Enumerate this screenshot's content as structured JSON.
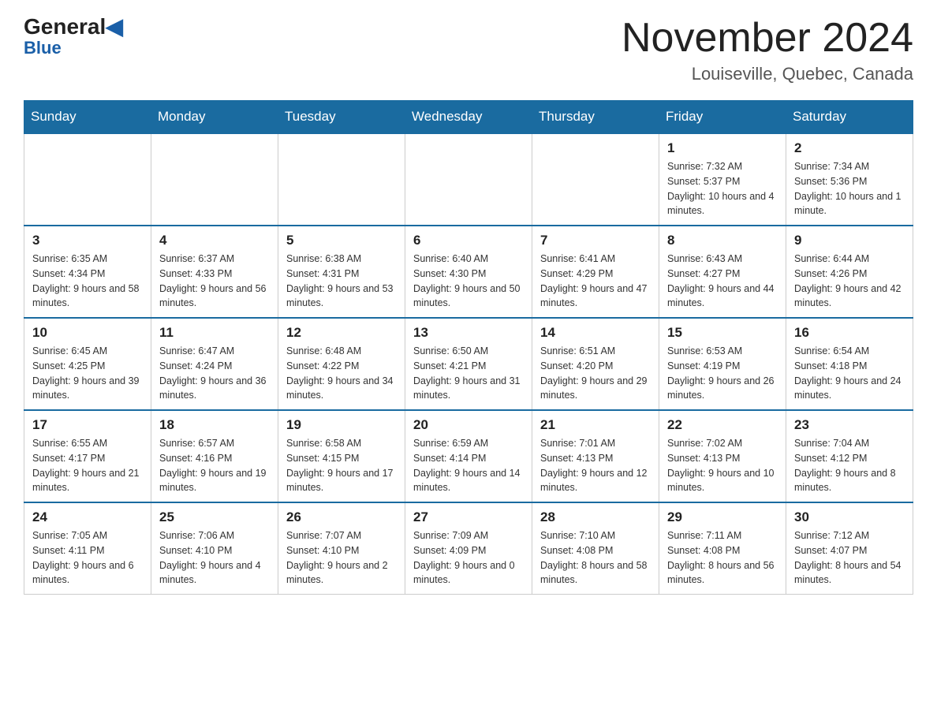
{
  "header": {
    "logo": {
      "general": "General",
      "blue": "Blue"
    },
    "month_title": "November 2024",
    "location": "Louiseville, Quebec, Canada"
  },
  "days_of_week": [
    "Sunday",
    "Monday",
    "Tuesday",
    "Wednesday",
    "Thursday",
    "Friday",
    "Saturday"
  ],
  "weeks": [
    [
      {
        "day": "",
        "info": ""
      },
      {
        "day": "",
        "info": ""
      },
      {
        "day": "",
        "info": ""
      },
      {
        "day": "",
        "info": ""
      },
      {
        "day": "",
        "info": ""
      },
      {
        "day": "1",
        "info": "Sunrise: 7:32 AM\nSunset: 5:37 PM\nDaylight: 10 hours and 4 minutes."
      },
      {
        "day": "2",
        "info": "Sunrise: 7:34 AM\nSunset: 5:36 PM\nDaylight: 10 hours and 1 minute."
      }
    ],
    [
      {
        "day": "3",
        "info": "Sunrise: 6:35 AM\nSunset: 4:34 PM\nDaylight: 9 hours and 58 minutes."
      },
      {
        "day": "4",
        "info": "Sunrise: 6:37 AM\nSunset: 4:33 PM\nDaylight: 9 hours and 56 minutes."
      },
      {
        "day": "5",
        "info": "Sunrise: 6:38 AM\nSunset: 4:31 PM\nDaylight: 9 hours and 53 minutes."
      },
      {
        "day": "6",
        "info": "Sunrise: 6:40 AM\nSunset: 4:30 PM\nDaylight: 9 hours and 50 minutes."
      },
      {
        "day": "7",
        "info": "Sunrise: 6:41 AM\nSunset: 4:29 PM\nDaylight: 9 hours and 47 minutes."
      },
      {
        "day": "8",
        "info": "Sunrise: 6:43 AM\nSunset: 4:27 PM\nDaylight: 9 hours and 44 minutes."
      },
      {
        "day": "9",
        "info": "Sunrise: 6:44 AM\nSunset: 4:26 PM\nDaylight: 9 hours and 42 minutes."
      }
    ],
    [
      {
        "day": "10",
        "info": "Sunrise: 6:45 AM\nSunset: 4:25 PM\nDaylight: 9 hours and 39 minutes."
      },
      {
        "day": "11",
        "info": "Sunrise: 6:47 AM\nSunset: 4:24 PM\nDaylight: 9 hours and 36 minutes."
      },
      {
        "day": "12",
        "info": "Sunrise: 6:48 AM\nSunset: 4:22 PM\nDaylight: 9 hours and 34 minutes."
      },
      {
        "day": "13",
        "info": "Sunrise: 6:50 AM\nSunset: 4:21 PM\nDaylight: 9 hours and 31 minutes."
      },
      {
        "day": "14",
        "info": "Sunrise: 6:51 AM\nSunset: 4:20 PM\nDaylight: 9 hours and 29 minutes."
      },
      {
        "day": "15",
        "info": "Sunrise: 6:53 AM\nSunset: 4:19 PM\nDaylight: 9 hours and 26 minutes."
      },
      {
        "day": "16",
        "info": "Sunrise: 6:54 AM\nSunset: 4:18 PM\nDaylight: 9 hours and 24 minutes."
      }
    ],
    [
      {
        "day": "17",
        "info": "Sunrise: 6:55 AM\nSunset: 4:17 PM\nDaylight: 9 hours and 21 minutes."
      },
      {
        "day": "18",
        "info": "Sunrise: 6:57 AM\nSunset: 4:16 PM\nDaylight: 9 hours and 19 minutes."
      },
      {
        "day": "19",
        "info": "Sunrise: 6:58 AM\nSunset: 4:15 PM\nDaylight: 9 hours and 17 minutes."
      },
      {
        "day": "20",
        "info": "Sunrise: 6:59 AM\nSunset: 4:14 PM\nDaylight: 9 hours and 14 minutes."
      },
      {
        "day": "21",
        "info": "Sunrise: 7:01 AM\nSunset: 4:13 PM\nDaylight: 9 hours and 12 minutes."
      },
      {
        "day": "22",
        "info": "Sunrise: 7:02 AM\nSunset: 4:13 PM\nDaylight: 9 hours and 10 minutes."
      },
      {
        "day": "23",
        "info": "Sunrise: 7:04 AM\nSunset: 4:12 PM\nDaylight: 9 hours and 8 minutes."
      }
    ],
    [
      {
        "day": "24",
        "info": "Sunrise: 7:05 AM\nSunset: 4:11 PM\nDaylight: 9 hours and 6 minutes."
      },
      {
        "day": "25",
        "info": "Sunrise: 7:06 AM\nSunset: 4:10 PM\nDaylight: 9 hours and 4 minutes."
      },
      {
        "day": "26",
        "info": "Sunrise: 7:07 AM\nSunset: 4:10 PM\nDaylight: 9 hours and 2 minutes."
      },
      {
        "day": "27",
        "info": "Sunrise: 7:09 AM\nSunset: 4:09 PM\nDaylight: 9 hours and 0 minutes."
      },
      {
        "day": "28",
        "info": "Sunrise: 7:10 AM\nSunset: 4:08 PM\nDaylight: 8 hours and 58 minutes."
      },
      {
        "day": "29",
        "info": "Sunrise: 7:11 AM\nSunset: 4:08 PM\nDaylight: 8 hours and 56 minutes."
      },
      {
        "day": "30",
        "info": "Sunrise: 7:12 AM\nSunset: 4:07 PM\nDaylight: 8 hours and 54 minutes."
      }
    ]
  ]
}
